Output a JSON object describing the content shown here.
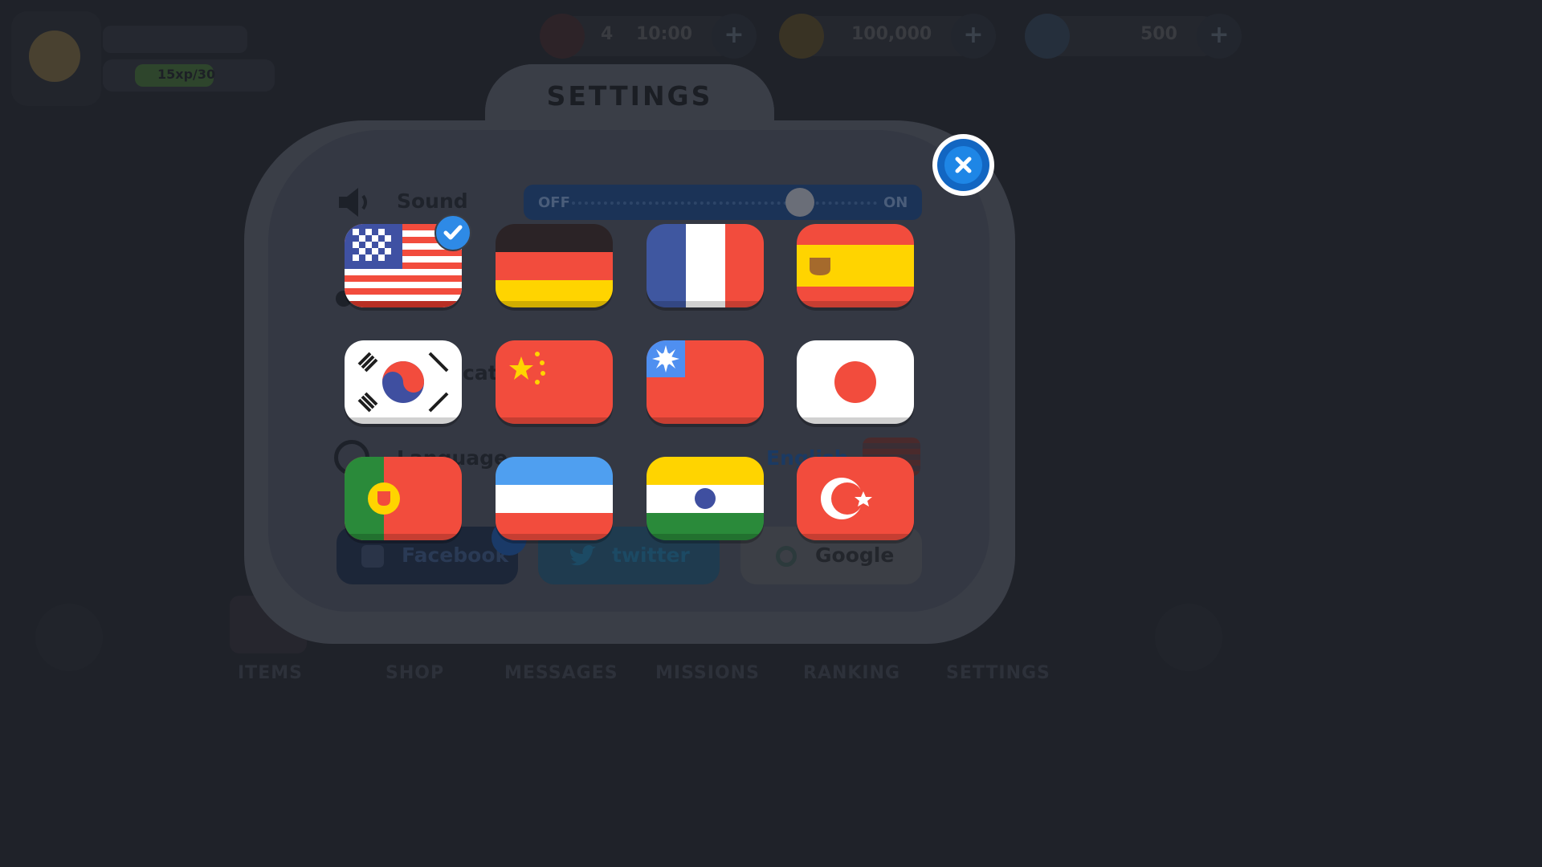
{
  "hud": {
    "level_text": "15xp/30",
    "lives_count": "4",
    "lives_timer": "10:00",
    "coins": "100,000",
    "gems": "500",
    "nav": [
      "ITEMS",
      "SHOP",
      "MESSAGES",
      "MISSIONS",
      "RANKING",
      "SETTINGS"
    ]
  },
  "settings": {
    "title": "SETTINGS",
    "sound_label": "Sound",
    "toggle_off": "OFF",
    "toggle_on": "ON",
    "notifications_fragment": "cat",
    "language_label": "Language",
    "language_value": "English",
    "social": {
      "facebook": "Facebook",
      "twitter": "twitter",
      "google": "Google"
    }
  },
  "languages": {
    "selected": "united-states",
    "flags": [
      "united-states",
      "germany",
      "france",
      "spain",
      "south-korea",
      "china",
      "taiwan",
      "japan",
      "portugal",
      "serbia",
      "india",
      "turkey"
    ]
  },
  "colors": {
    "panel": "#3a3e47",
    "selected_check": "#2e8ae6",
    "close_button": "#1e86e6"
  }
}
